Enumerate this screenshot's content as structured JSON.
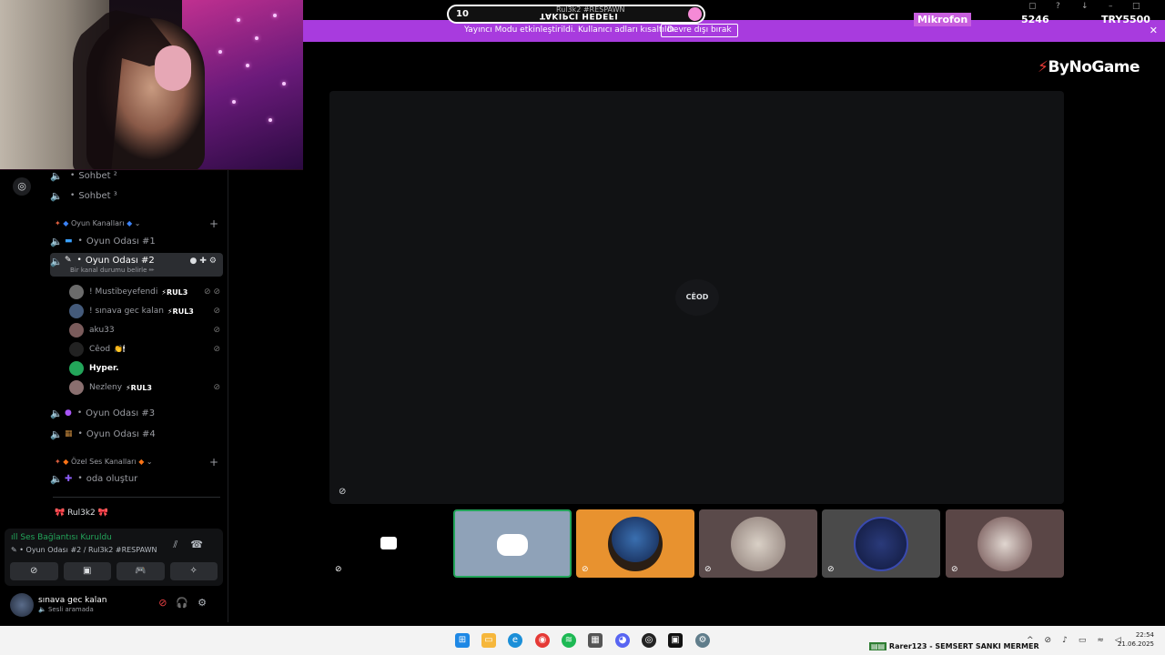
{
  "overlay": {
    "follow_count": "10",
    "follow_label": "TAKIPCI HEDEFI",
    "follow_sub": "Rul3k2 #RESPAWN",
    "mic_label": "Mikrofon",
    "stat1": "5246",
    "stat2": "TRY5500",
    "brand": "ByNoGame",
    "brand_bolt": "⚡"
  },
  "streamer_bar": {
    "notice": "Yayıncı Modu etkinleştirildi. Kullanıcı adları kısaltıldı.",
    "disable_label": "Devre dışı bırak",
    "close": "✕"
  },
  "channels": {
    "sohbet2": "Sohbet ²",
    "sohbet3": "Sohbet ³",
    "cat_games": "Oyun Kanalları",
    "oda1": "Oyun Odası #1",
    "oda2": "Oyun Odası #2",
    "oda2_sub": "Bir kanal durumu belirle ✏",
    "oda3": "Oyun Odası #3",
    "oda4": "Oyun Odası #4",
    "cat_private": "Özel Ses Kanalları",
    "create_room": "oda oluştur",
    "server_title": "🎀 Rul3k2 🎀"
  },
  "voice_users": [
    {
      "name": "! Mustibeyefendi",
      "tag": "⚡RUL3"
    },
    {
      "name": "! sınava gec kalan",
      "tag": "⚡RUL3"
    },
    {
      "name": "aku33",
      "tag": ""
    },
    {
      "name": "Cêod",
      "tag": "👏🕯"
    },
    {
      "name": "Hyper.",
      "tag": ""
    },
    {
      "name": "Nezleny",
      "tag": "⚡RUL3"
    }
  ],
  "voice_panel": {
    "status": "Ses Bağlantısı Kuruldu",
    "where": "Oyun Odası #2 / Rul3k2 #RESPAWN"
  },
  "user_panel": {
    "name": "sınava gec kalan",
    "state": "Sesli aramada"
  },
  "stage": {
    "center_name": "CÊOD"
  },
  "taskbar": {
    "tray_text": "Rarer123 - SEMSERT SANKI MERMER",
    "time": "22:54",
    "date": "21.06.2025"
  },
  "colors": {
    "streamer_purple": "#a83bde",
    "connected_green": "#23a55a",
    "tile_orange": "#e8922f",
    "tile_selected": "#8fa2b8"
  }
}
